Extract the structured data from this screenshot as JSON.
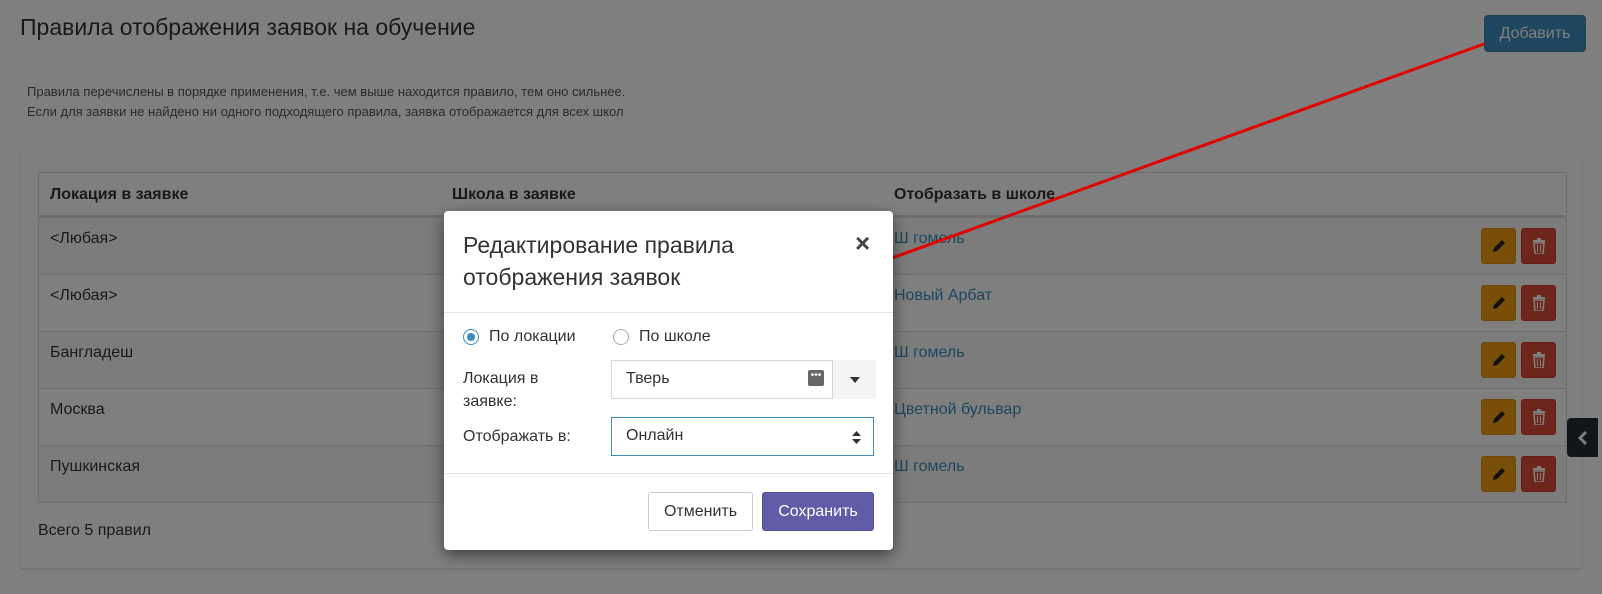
{
  "page": {
    "title": "Правила отображения заявок на обучение",
    "add_label": "Добавить",
    "help_line1": "Правила перечислены в порядке применения, т.е. чем выше находится правило, тем оно сильнее.",
    "help_line2": "Если для заявки не найдено ни одного подходящего правила, заявка отображается для всех школ",
    "total": "Всего 5 правил"
  },
  "table": {
    "headers": [
      "Локация в заявке",
      "Школа в заявке",
      "Отобразать в школе"
    ],
    "rows": [
      {
        "location": "<Любая>",
        "school": "",
        "display": "Ш гомель"
      },
      {
        "location": "<Любая>",
        "school": "",
        "display": "Новый Арбат"
      },
      {
        "location": "Бангладеш",
        "school": "",
        "display": "Ш гомель"
      },
      {
        "location": "Москва",
        "school": "",
        "display": "Цветной бульвар"
      },
      {
        "location": "Пушкинская",
        "school": "",
        "display": "Ш гомель"
      }
    ]
  },
  "modal": {
    "title": "Редактирование правила отображения заявок",
    "close": "×",
    "radio_location": "По локации",
    "radio_school": "По школе",
    "location_label": "Локация в заявке:",
    "location_value": "Тверь",
    "display_label": "Отображать в:",
    "display_value": "Онлайн",
    "cancel_label": "Отменить",
    "save_label": "Сохранить"
  },
  "colors": {
    "primary": "#3c8dbc",
    "warning": "#f39c12",
    "danger": "#dd4b39",
    "purple": "#605ca8",
    "arrow": "#e00000"
  },
  "icons": [
    "pencil-icon",
    "trash-icon",
    "chevron-left-icon",
    "ellipsis-icon",
    "caret-down-icon",
    "sort-icon",
    "arrow-annotation"
  ]
}
